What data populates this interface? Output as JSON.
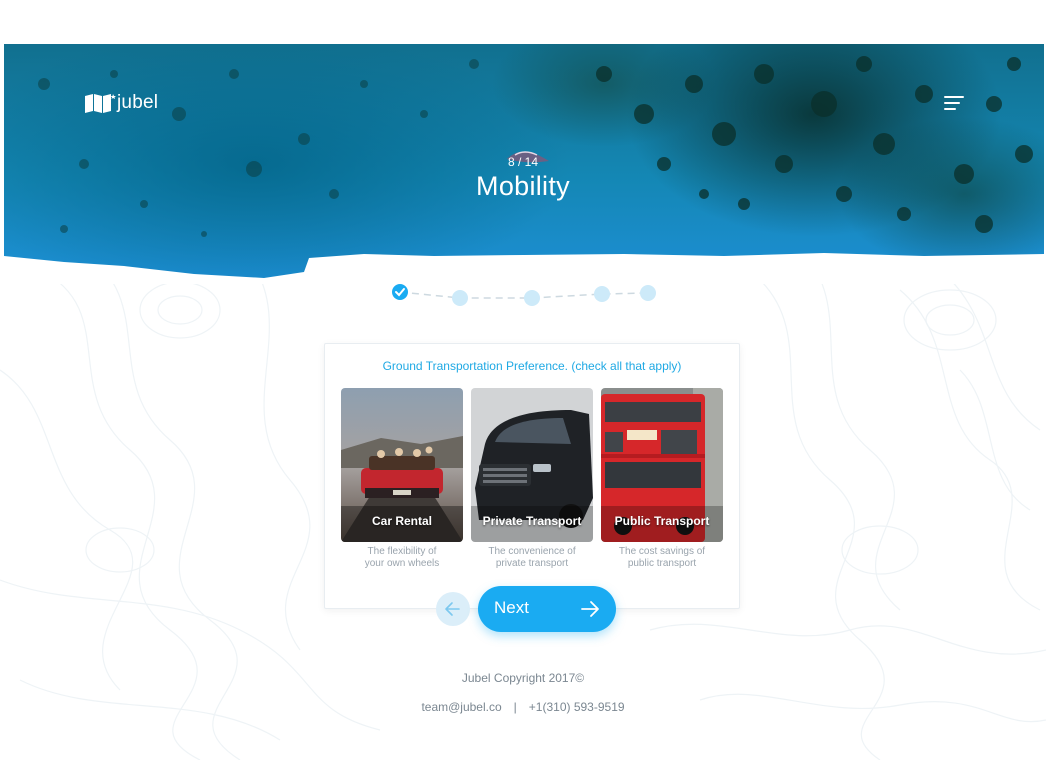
{
  "brand": {
    "name": "jubel",
    "logo_icon": "open-map-icon"
  },
  "header": {
    "menu_icon": "hamburger-menu-icon"
  },
  "step": {
    "counter": "8 / 14",
    "title": "Mobility",
    "icon": "boat-icon"
  },
  "progress": {
    "steps": 5,
    "completed": 1,
    "check_icon": "check-icon"
  },
  "question": {
    "text": "Ground Transportation Preference. (check all that apply)",
    "options": [
      {
        "label": "Car Rental",
        "desc_line1": "The flexibility of",
        "desc_line2": "your own wheels",
        "image": "red-convertible-photo"
      },
      {
        "label": "Private Transport",
        "desc_line1": "The convenience of",
        "desc_line2": "private transport",
        "image": "black-van-photo"
      },
      {
        "label": "Public Transport",
        "desc_line1": "The cost savings of",
        "desc_line2": "public transport",
        "image": "red-double-decker-bus-photo"
      }
    ]
  },
  "nav": {
    "prev_icon": "arrow-left-icon",
    "next_label": "Next",
    "next_icon": "arrow-right-icon"
  },
  "footer": {
    "copyright": "Jubel Copyright 2017©",
    "email": "team@jubel.co",
    "separator": "|",
    "phone": "+1(310) 593-9519"
  },
  "colors": {
    "accent": "#1aabf2",
    "question": "#1fa9e4",
    "footer_text": "#7b8791",
    "progress_inactive": "#cdeaf9"
  }
}
